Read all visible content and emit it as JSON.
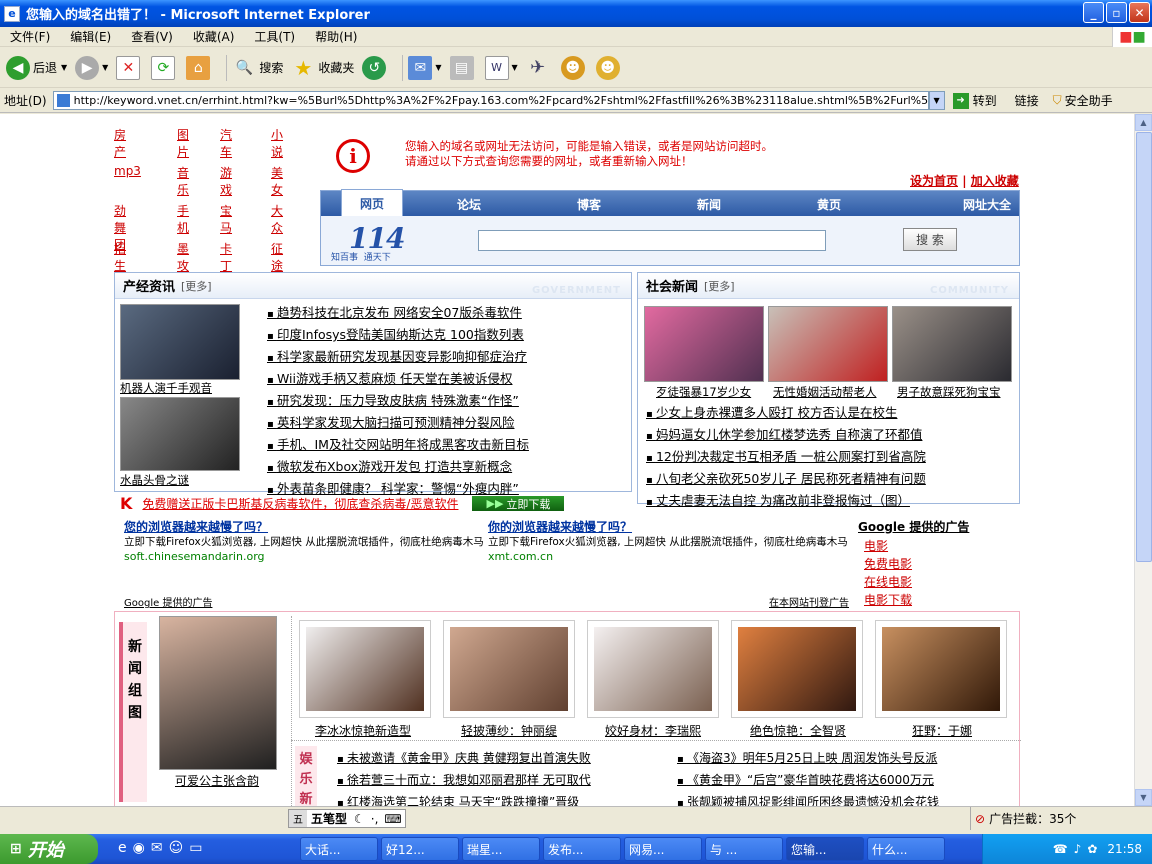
{
  "window": {
    "title": "您输入的域名出错了！ - Microsoft Internet Explorer"
  },
  "menu": [
    "文件(F)",
    "编辑(E)",
    "查看(V)",
    "收藏(A)",
    "工具(T)",
    "帮助(H)"
  ],
  "toolbar": {
    "back": "后退",
    "search": "搜索",
    "favorites": "收藏夹"
  },
  "address": {
    "label": "地址(D)",
    "url": "http://keyword.vnet.cn/errhint.html?kw=%5Burl%5Dhttp%3A%2F%2Fpay.163.com%2Fpcard%2Fshtml%2Ffastfill%26%3B%23118alue.shtml%5B%2Furl%5D",
    "go": "转到",
    "links": "链接",
    "security": "安全助手"
  },
  "page": {
    "cats": [
      [
        "房产",
        "图片",
        "汽车",
        "小说"
      ],
      [
        "mp3",
        "音乐",
        "游戏",
        "美女"
      ],
      [
        "劲舞团",
        "手机",
        "宝马",
        "大众"
      ],
      [
        "招生",
        "墨攻",
        "卡丁车",
        "征途"
      ]
    ],
    "error_line1": "您输入的域名或网址无法访问，可能是输入错误，或者是网站访问超时。",
    "error_line2": "请通过以下方式查询您需要的网址，或者重新输入网址！",
    "set_home": "设为首页",
    "sep": "|",
    "add_fav": "加入收藏",
    "tabs": [
      "网页",
      "论坛",
      "博客",
      "新闻",
      "黄页",
      "网址大全"
    ],
    "logo_num": "114",
    "logo_sub": "知百事  通天下",
    "search_btn": "搜 索",
    "left_box": {
      "title": "产经资讯",
      "more": "[更多]",
      "eng": "GOVERNMENT",
      "pic1": "机器人演千手观音",
      "pic2": "水晶头骨之谜",
      "items": [
        "趋势科技在北京发布 网络安全07版杀毒软件",
        "印度Infosys登陆美国纳斯达克 100指数列表",
        "科学家最新研究发现基因变异影响抑郁症治疗",
        "Wii游戏手柄又惹麻烦 任天堂在美被诉侵权",
        "研究发现：压力导致皮肤病 特殊激素“作怪”",
        "英科学家发现大脑扫描可预测精神分裂风险",
        "手机、IM及社交网站明年将成黑客攻击新目标",
        "微软发布Xbox游戏开发包 打造共享新概念",
        "外表苗条即健康？ 科学家：警惕“外瘦内胖”"
      ]
    },
    "right_box": {
      "title": "社会新闻",
      "more": "[更多]",
      "eng": "COMMUNITY",
      "pics": [
        "歹徒强暴17岁少女",
        "无性婚姻活动帮老人",
        "男子故意踩死狗宝宝"
      ],
      "items": [
        "少女上身赤裸遭多人殴打 校方否认是在校生",
        "妈妈逼女儿休学参加红楼梦选秀 自称演了环都值",
        "12份判决裁定书互相矛盾 一桩公厕案打到省高院",
        "八旬老父亲砍死50岁儿子 居民称死者精神有问题",
        "丈夫虐妻无法自控 为痛改前非登报悔过（图）"
      ]
    },
    "kav": {
      "text": "免费赠送正版卡巴斯基反病毒软件，彻底查杀病毒/恶意软件",
      "btn": "立即下载"
    },
    "ads": [
      {
        "title": "您的浏览器越来越慢了吗？",
        "desc": "立即下载Firefox火狐浏览器, 上网超快 从此摆脱流氓插件，彻底杜绝病毒木马",
        "url": "soft.chinesemandarin.org"
      },
      {
        "title": "你的浏览器越来越慢了吗？",
        "desc": "立即下载Firefox火狐浏览器, 上网超快 从此摆脱流氓插件，彻底杜绝病毒木马",
        "url": "xmt.com.cn"
      }
    ],
    "google_label": "Google 提供的广告",
    "google_links_title": "Google 提供的广告",
    "google_links": [
      "电影",
      "免费电影",
      "在线电影",
      "电影下载"
    ],
    "adv_here": "在本网站刊登广告",
    "ent": {
      "side": [
        "新",
        "闻",
        "组",
        "图"
      ],
      "main_cap": "可爱公主张含韵",
      "caps": [
        "李冰冰惊艳新造型",
        "轻披薄纱：钟丽缇",
        "姣好身材：李瑞熙",
        "绝色惊艳：全智贤",
        "狂野：于娜"
      ],
      "side2": [
        "娱",
        "乐",
        "新"
      ],
      "news_left": [
        "未被邀请《黄金甲》庆典 黄健翔复出首演失败",
        "徐若萱三十而立：我想如邓丽君那样 无可取代",
        "红楼海选第二轮结束 马天宇“跌跌撞撞”晋级"
      ],
      "news_right": [
        "《海盗3》明年5月25日上映 周润发饰头号反派",
        "《黄金甲》“后宫”豪华首映花费将达6000万元",
        "张靓颖被捕风捉影绯闻所困终最遗憾没机会花钱"
      ]
    }
  },
  "status": {
    "ime": "五笔型",
    "ad_block": "广告拦截：35个"
  },
  "taskbar": {
    "start": "开始",
    "tasks": [
      "大话...",
      "好12...",
      "瑞星...",
      "发布...",
      "网易...",
      "与 ...",
      "您输...",
      "什么..."
    ],
    "clock": "21:58"
  }
}
